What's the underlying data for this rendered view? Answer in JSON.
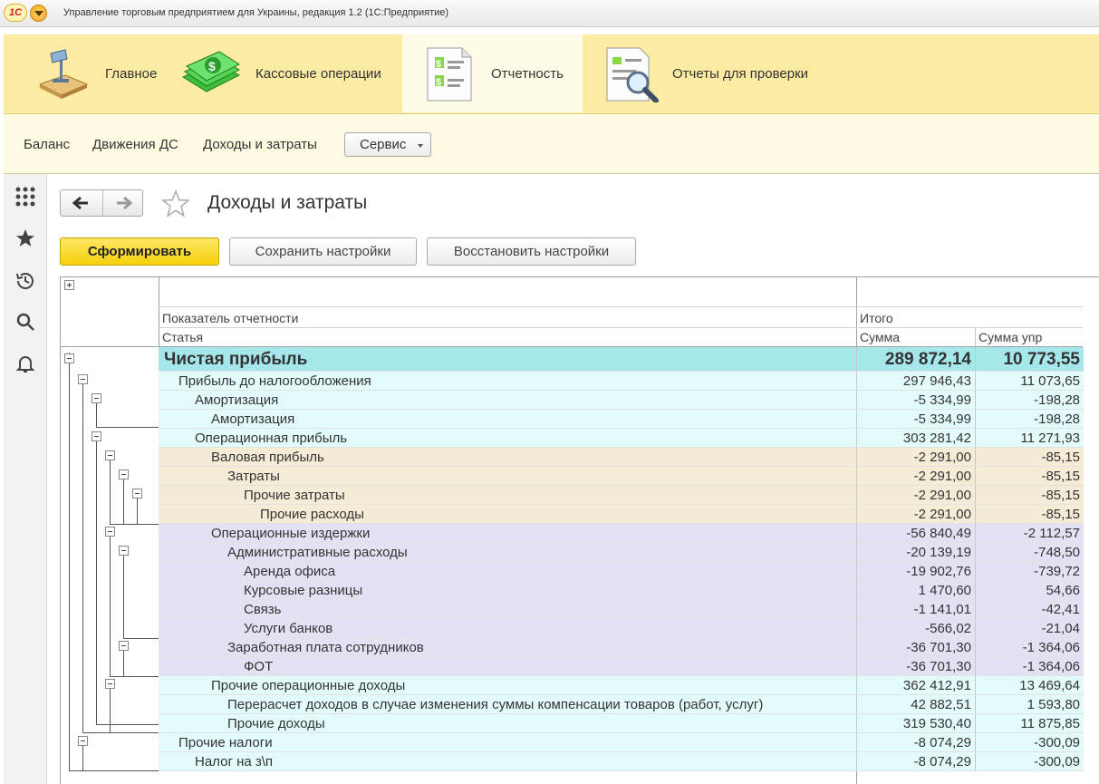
{
  "window": {
    "title": "Управление торговым предприятием для Украины, редакция 1.2  (1С:Предприятие)",
    "logo_text": "1С"
  },
  "sections": [
    {
      "label": "Главное",
      "icon": "desk-lamp-icon"
    },
    {
      "label": "Кассовые операции",
      "icon": "money-icon"
    },
    {
      "label": "Отчетность",
      "icon": "report-document-icon",
      "active": true
    },
    {
      "label": "Отчеты для проверки",
      "icon": "report-magnifier-icon"
    }
  ],
  "subnav": {
    "links": [
      "Баланс",
      "Движения ДС",
      "Доходы и затраты"
    ],
    "service_label": "Сервис"
  },
  "left_panel": [
    "apps-grid-icon",
    "star-icon",
    "history-icon",
    "search-icon",
    "bell-icon"
  ],
  "page": {
    "title": "Доходы и затраты"
  },
  "toolbar": {
    "generate": "Сформировать",
    "save_settings": "Сохранить настройки",
    "restore_settings": "Восстановить настройки"
  },
  "report": {
    "header": {
      "indicator": "Показатель отчетности",
      "article": "Статья",
      "total": "Итого",
      "sum": "Сумма",
      "sum_mgmt": "Сумма упр"
    },
    "colors": {
      "cyan": "#a6e7ec",
      "light_cyan": "#e3fbfb",
      "beige": "#f5ecd7",
      "lavender": "#e3e2f5"
    },
    "rows": [
      {
        "name": "Чистая прибыль",
        "sum": "289 872,14",
        "sum_mgmt": "10 773,55"
      },
      {
        "name": "Прибыль до налогообложения",
        "sum": "297 946,43",
        "sum_mgmt": "11 073,65"
      },
      {
        "name": "Амортизация",
        "sum": "-5 334,99",
        "sum_mgmt": "-198,28"
      },
      {
        "name": "Амортизация",
        "sum": "-5 334,99",
        "sum_mgmt": "-198,28"
      },
      {
        "name": "Операционная прибыль",
        "sum": "303 281,42",
        "sum_mgmt": "11 271,93"
      },
      {
        "name": "Валовая прибыль",
        "sum": "-2 291,00",
        "sum_mgmt": "-85,15"
      },
      {
        "name": "Затраты",
        "sum": "-2 291,00",
        "sum_mgmt": "-85,15"
      },
      {
        "name": "Прочие затраты",
        "sum": "-2 291,00",
        "sum_mgmt": "-85,15"
      },
      {
        "name": "Прочие расходы",
        "sum": "-2 291,00",
        "sum_mgmt": "-85,15"
      },
      {
        "name": "Операционные издержки",
        "sum": "-56 840,49",
        "sum_mgmt": "-2 112,57"
      },
      {
        "name": "Административные расходы",
        "sum": "-20 139,19",
        "sum_mgmt": "-748,50"
      },
      {
        "name": "Аренда офиса",
        "sum": "-19 902,76",
        "sum_mgmt": "-739,72"
      },
      {
        "name": "Курсовые разницы",
        "sum": "1 470,60",
        "sum_mgmt": "54,66"
      },
      {
        "name": "Связь",
        "sum": "-1 141,01",
        "sum_mgmt": "-42,41"
      },
      {
        "name": "Услуги банков",
        "sum": "-566,02",
        "sum_mgmt": "-21,04"
      },
      {
        "name": "Заработная плата сотрудников",
        "sum": "-36 701,30",
        "sum_mgmt": "-1 364,06"
      },
      {
        "name": "ФОТ",
        "sum": "-36 701,30",
        "sum_mgmt": "-1 364,06"
      },
      {
        "name": "Прочие операционные доходы",
        "sum": "362 412,91",
        "sum_mgmt": "13 469,64"
      },
      {
        "name": "Перерасчет доходов в случае изменения суммы компенсации товаров (работ, услуг)",
        "sum": "42 882,51",
        "sum_mgmt": "1 593,80"
      },
      {
        "name": "Прочие доходы",
        "sum": "319 530,40",
        "sum_mgmt": "11 875,85"
      },
      {
        "name": "Прочие налоги",
        "sum": "-8 074,29",
        "sum_mgmt": "-300,09"
      },
      {
        "name": "Налог на з\\п",
        "sum": "-8 074,29",
        "sum_mgmt": "-300,09"
      }
    ]
  }
}
